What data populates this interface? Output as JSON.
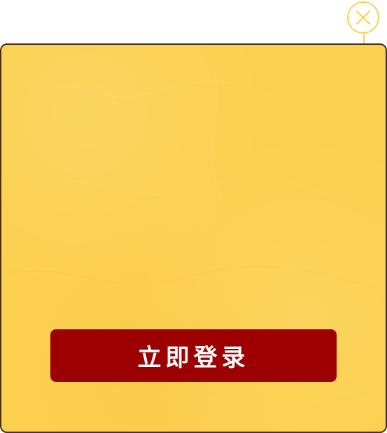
{
  "dialog": {
    "login_button_label": "立即登录",
    "close_icon": "close-icon"
  },
  "colors": {
    "panel_background": "#fcd04f",
    "panel_border": "#4a2e12",
    "button_background": "#9c0000",
    "button_text": "#ffffff",
    "close_ring": "#f6d25a"
  }
}
